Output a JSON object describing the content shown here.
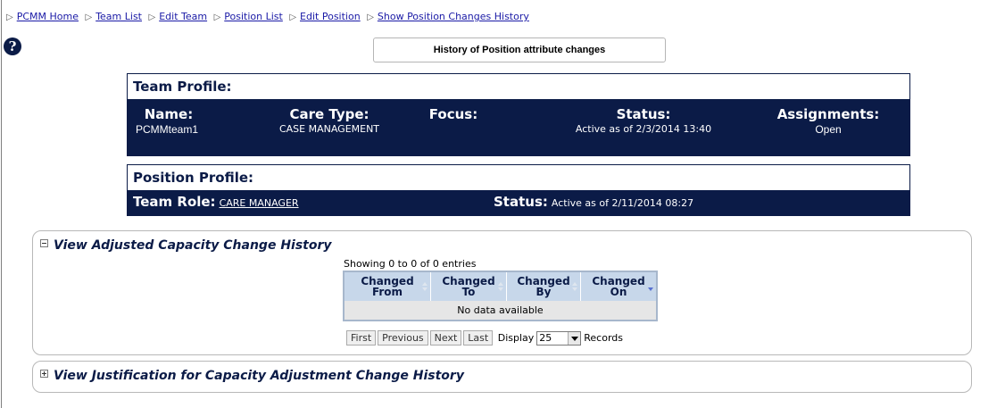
{
  "breadcrumb": {
    "items": [
      "PCMM Home",
      "Team List",
      "Edit Team",
      "Position List",
      "Edit Position",
      "Show Position Changes History"
    ]
  },
  "help": {
    "glyph": "?",
    "icon": "help-icon"
  },
  "page_title": "History of Position attribute changes",
  "team_profile": {
    "heading": "Team Profile:",
    "name_label": "Name:",
    "name_value": "PCMMteam1",
    "care_label": "Care Type:",
    "care_value": "CASE MANAGEMENT",
    "focus_label": "Focus:",
    "focus_value": "",
    "status_label": "Status:",
    "status_value": "Active as of 2/3/2014 13:40",
    "assign_label": "Assignments:",
    "assign_value": "Open"
  },
  "position_profile": {
    "heading": "Position Profile:",
    "role_label": "Team Role:",
    "role_value": "CARE MANAGER",
    "status_label": "Status:",
    "status_value": "Active as of 2/11/2014 08:27"
  },
  "adjusted_section": {
    "title": "View Adjusted Capacity Change History",
    "showing": "Showing 0 to 0 of 0 entries",
    "columns": [
      {
        "line1": "Changed",
        "line2": "From"
      },
      {
        "line1": "Changed",
        "line2": "To"
      },
      {
        "line1": "Changed",
        "line2": "By"
      },
      {
        "line1": "Changed",
        "line2": "On"
      }
    ],
    "empty_text": "No data available",
    "pager": {
      "first": "First",
      "previous": "Previous",
      "next": "Next",
      "last": "Last",
      "display_label": "Display",
      "display_value": "25",
      "records_label": "Records"
    }
  },
  "justification_section": {
    "title": "View Justification for Capacity Adjustment Change History"
  },
  "colors": {
    "navy": "#0b1b47",
    "link": "#1a1aa6",
    "grid_header": "#c7d7ea"
  }
}
